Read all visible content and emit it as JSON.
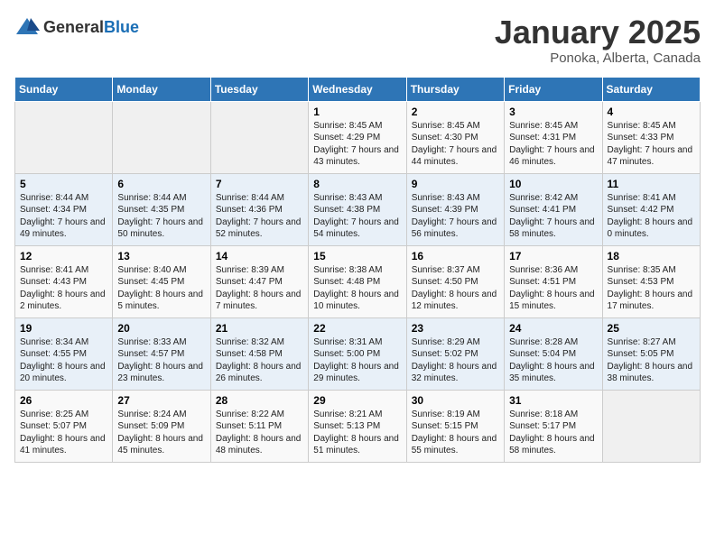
{
  "header": {
    "logo_general": "General",
    "logo_blue": "Blue",
    "title": "January 2025",
    "subtitle": "Ponoka, Alberta, Canada"
  },
  "weekdays": [
    "Sunday",
    "Monday",
    "Tuesday",
    "Wednesday",
    "Thursday",
    "Friday",
    "Saturday"
  ],
  "weeks": [
    [
      {
        "day": "",
        "sunrise": "",
        "sunset": "",
        "daylight": ""
      },
      {
        "day": "",
        "sunrise": "",
        "sunset": "",
        "daylight": ""
      },
      {
        "day": "",
        "sunrise": "",
        "sunset": "",
        "daylight": ""
      },
      {
        "day": "1",
        "sunrise": "Sunrise: 8:45 AM",
        "sunset": "Sunset: 4:29 PM",
        "daylight": "Daylight: 7 hours and 43 minutes."
      },
      {
        "day": "2",
        "sunrise": "Sunrise: 8:45 AM",
        "sunset": "Sunset: 4:30 PM",
        "daylight": "Daylight: 7 hours and 44 minutes."
      },
      {
        "day": "3",
        "sunrise": "Sunrise: 8:45 AM",
        "sunset": "Sunset: 4:31 PM",
        "daylight": "Daylight: 7 hours and 46 minutes."
      },
      {
        "day": "4",
        "sunrise": "Sunrise: 8:45 AM",
        "sunset": "Sunset: 4:33 PM",
        "daylight": "Daylight: 7 hours and 47 minutes."
      }
    ],
    [
      {
        "day": "5",
        "sunrise": "Sunrise: 8:44 AM",
        "sunset": "Sunset: 4:34 PM",
        "daylight": "Daylight: 7 hours and 49 minutes."
      },
      {
        "day": "6",
        "sunrise": "Sunrise: 8:44 AM",
        "sunset": "Sunset: 4:35 PM",
        "daylight": "Daylight: 7 hours and 50 minutes."
      },
      {
        "day": "7",
        "sunrise": "Sunrise: 8:44 AM",
        "sunset": "Sunset: 4:36 PM",
        "daylight": "Daylight: 7 hours and 52 minutes."
      },
      {
        "day": "8",
        "sunrise": "Sunrise: 8:43 AM",
        "sunset": "Sunset: 4:38 PM",
        "daylight": "Daylight: 7 hours and 54 minutes."
      },
      {
        "day": "9",
        "sunrise": "Sunrise: 8:43 AM",
        "sunset": "Sunset: 4:39 PM",
        "daylight": "Daylight: 7 hours and 56 minutes."
      },
      {
        "day": "10",
        "sunrise": "Sunrise: 8:42 AM",
        "sunset": "Sunset: 4:41 PM",
        "daylight": "Daylight: 7 hours and 58 minutes."
      },
      {
        "day": "11",
        "sunrise": "Sunrise: 8:41 AM",
        "sunset": "Sunset: 4:42 PM",
        "daylight": "Daylight: 8 hours and 0 minutes."
      }
    ],
    [
      {
        "day": "12",
        "sunrise": "Sunrise: 8:41 AM",
        "sunset": "Sunset: 4:43 PM",
        "daylight": "Daylight: 8 hours and 2 minutes."
      },
      {
        "day": "13",
        "sunrise": "Sunrise: 8:40 AM",
        "sunset": "Sunset: 4:45 PM",
        "daylight": "Daylight: 8 hours and 5 minutes."
      },
      {
        "day": "14",
        "sunrise": "Sunrise: 8:39 AM",
        "sunset": "Sunset: 4:47 PM",
        "daylight": "Daylight: 8 hours and 7 minutes."
      },
      {
        "day": "15",
        "sunrise": "Sunrise: 8:38 AM",
        "sunset": "Sunset: 4:48 PM",
        "daylight": "Daylight: 8 hours and 10 minutes."
      },
      {
        "day": "16",
        "sunrise": "Sunrise: 8:37 AM",
        "sunset": "Sunset: 4:50 PM",
        "daylight": "Daylight: 8 hours and 12 minutes."
      },
      {
        "day": "17",
        "sunrise": "Sunrise: 8:36 AM",
        "sunset": "Sunset: 4:51 PM",
        "daylight": "Daylight: 8 hours and 15 minutes."
      },
      {
        "day": "18",
        "sunrise": "Sunrise: 8:35 AM",
        "sunset": "Sunset: 4:53 PM",
        "daylight": "Daylight: 8 hours and 17 minutes."
      }
    ],
    [
      {
        "day": "19",
        "sunrise": "Sunrise: 8:34 AM",
        "sunset": "Sunset: 4:55 PM",
        "daylight": "Daylight: 8 hours and 20 minutes."
      },
      {
        "day": "20",
        "sunrise": "Sunrise: 8:33 AM",
        "sunset": "Sunset: 4:57 PM",
        "daylight": "Daylight: 8 hours and 23 minutes."
      },
      {
        "day": "21",
        "sunrise": "Sunrise: 8:32 AM",
        "sunset": "Sunset: 4:58 PM",
        "daylight": "Daylight: 8 hours and 26 minutes."
      },
      {
        "day": "22",
        "sunrise": "Sunrise: 8:31 AM",
        "sunset": "Sunset: 5:00 PM",
        "daylight": "Daylight: 8 hours and 29 minutes."
      },
      {
        "day": "23",
        "sunrise": "Sunrise: 8:29 AM",
        "sunset": "Sunset: 5:02 PM",
        "daylight": "Daylight: 8 hours and 32 minutes."
      },
      {
        "day": "24",
        "sunrise": "Sunrise: 8:28 AM",
        "sunset": "Sunset: 5:04 PM",
        "daylight": "Daylight: 8 hours and 35 minutes."
      },
      {
        "day": "25",
        "sunrise": "Sunrise: 8:27 AM",
        "sunset": "Sunset: 5:05 PM",
        "daylight": "Daylight: 8 hours and 38 minutes."
      }
    ],
    [
      {
        "day": "26",
        "sunrise": "Sunrise: 8:25 AM",
        "sunset": "Sunset: 5:07 PM",
        "daylight": "Daylight: 8 hours and 41 minutes."
      },
      {
        "day": "27",
        "sunrise": "Sunrise: 8:24 AM",
        "sunset": "Sunset: 5:09 PM",
        "daylight": "Daylight: 8 hours and 45 minutes."
      },
      {
        "day": "28",
        "sunrise": "Sunrise: 8:22 AM",
        "sunset": "Sunset: 5:11 PM",
        "daylight": "Daylight: 8 hours and 48 minutes."
      },
      {
        "day": "29",
        "sunrise": "Sunrise: 8:21 AM",
        "sunset": "Sunset: 5:13 PM",
        "daylight": "Daylight: 8 hours and 51 minutes."
      },
      {
        "day": "30",
        "sunrise": "Sunrise: 8:19 AM",
        "sunset": "Sunset: 5:15 PM",
        "daylight": "Daylight: 8 hours and 55 minutes."
      },
      {
        "day": "31",
        "sunrise": "Sunrise: 8:18 AM",
        "sunset": "Sunset: 5:17 PM",
        "daylight": "Daylight: 8 hours and 58 minutes."
      },
      {
        "day": "",
        "sunrise": "",
        "sunset": "",
        "daylight": ""
      }
    ]
  ]
}
